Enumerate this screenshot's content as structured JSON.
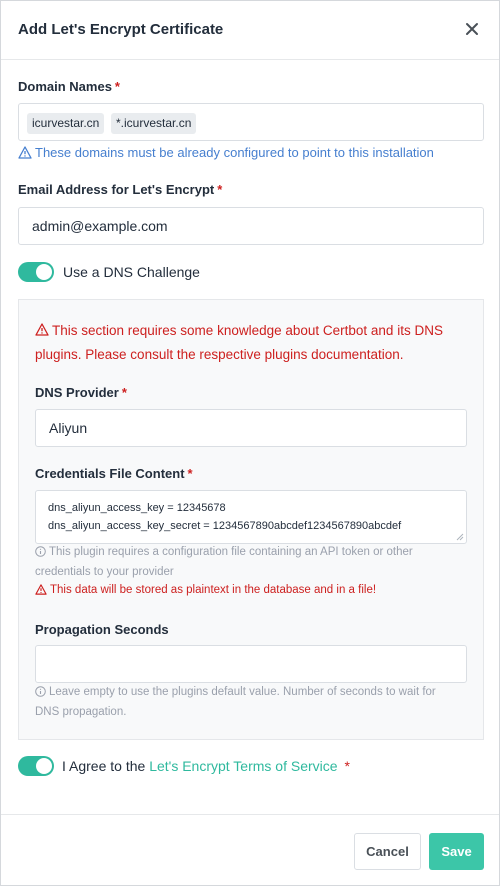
{
  "dialog": {
    "title": "Add Let's Encrypt Certificate",
    "close_icon": "close-icon"
  },
  "domains": {
    "label": "Domain Names",
    "required_mark": "*",
    "tags": [
      "icurvestar.cn",
      "*.icurvestar.cn"
    ],
    "hint": "These domains must be already configured to point to this installation",
    "hint_icon": "alert-triangle-icon"
  },
  "email": {
    "label": "Email Address for Let's Encrypt",
    "required_mark": "*",
    "value": "admin@example.com"
  },
  "dns_challenge": {
    "toggle_on": true,
    "label": "Use a DNS Challenge",
    "warning_line1": "This section requires some knowledge about Certbot and its DNS",
    "warning_line2": "plugins. Please consult the respective plugins documentation.",
    "warning_icon": "alert-triangle-icon",
    "provider_label": "DNS Provider",
    "provider_required": "*",
    "provider_value": "Aliyun",
    "credentials_label": "Credentials File Content",
    "credentials_required": "*",
    "credentials_lines": [
      "dns_aliyun_access_key = 12345678",
      "dns_aliyun_access_key_secret = 1234567890abcdef1234567890abcdef"
    ],
    "credentials_help_line1": "This plugin requires a configuration file containing an API token or other",
    "credentials_help_line2": "credentials to your provider",
    "credentials_warning": "This data will be stored as plaintext in the database and in a file!",
    "propagation_label": "Propagation Seconds",
    "propagation_value": "",
    "propagation_help_line1": "Leave empty to use the plugins default value. Number of seconds to wait for",
    "propagation_help_line2": "DNS propagation."
  },
  "agree": {
    "toggle_on": true,
    "prefix": "I Agree to the",
    "link": "Let's Encrypt Terms of Service",
    "required_mark": "*"
  },
  "footer": {
    "cancel_label": "Cancel",
    "save_label": "Save"
  },
  "colors": {
    "accent": "#2fb99e",
    "save_button": "#3cc6a8",
    "danger": "#cd201f",
    "info": "#467fcf"
  }
}
